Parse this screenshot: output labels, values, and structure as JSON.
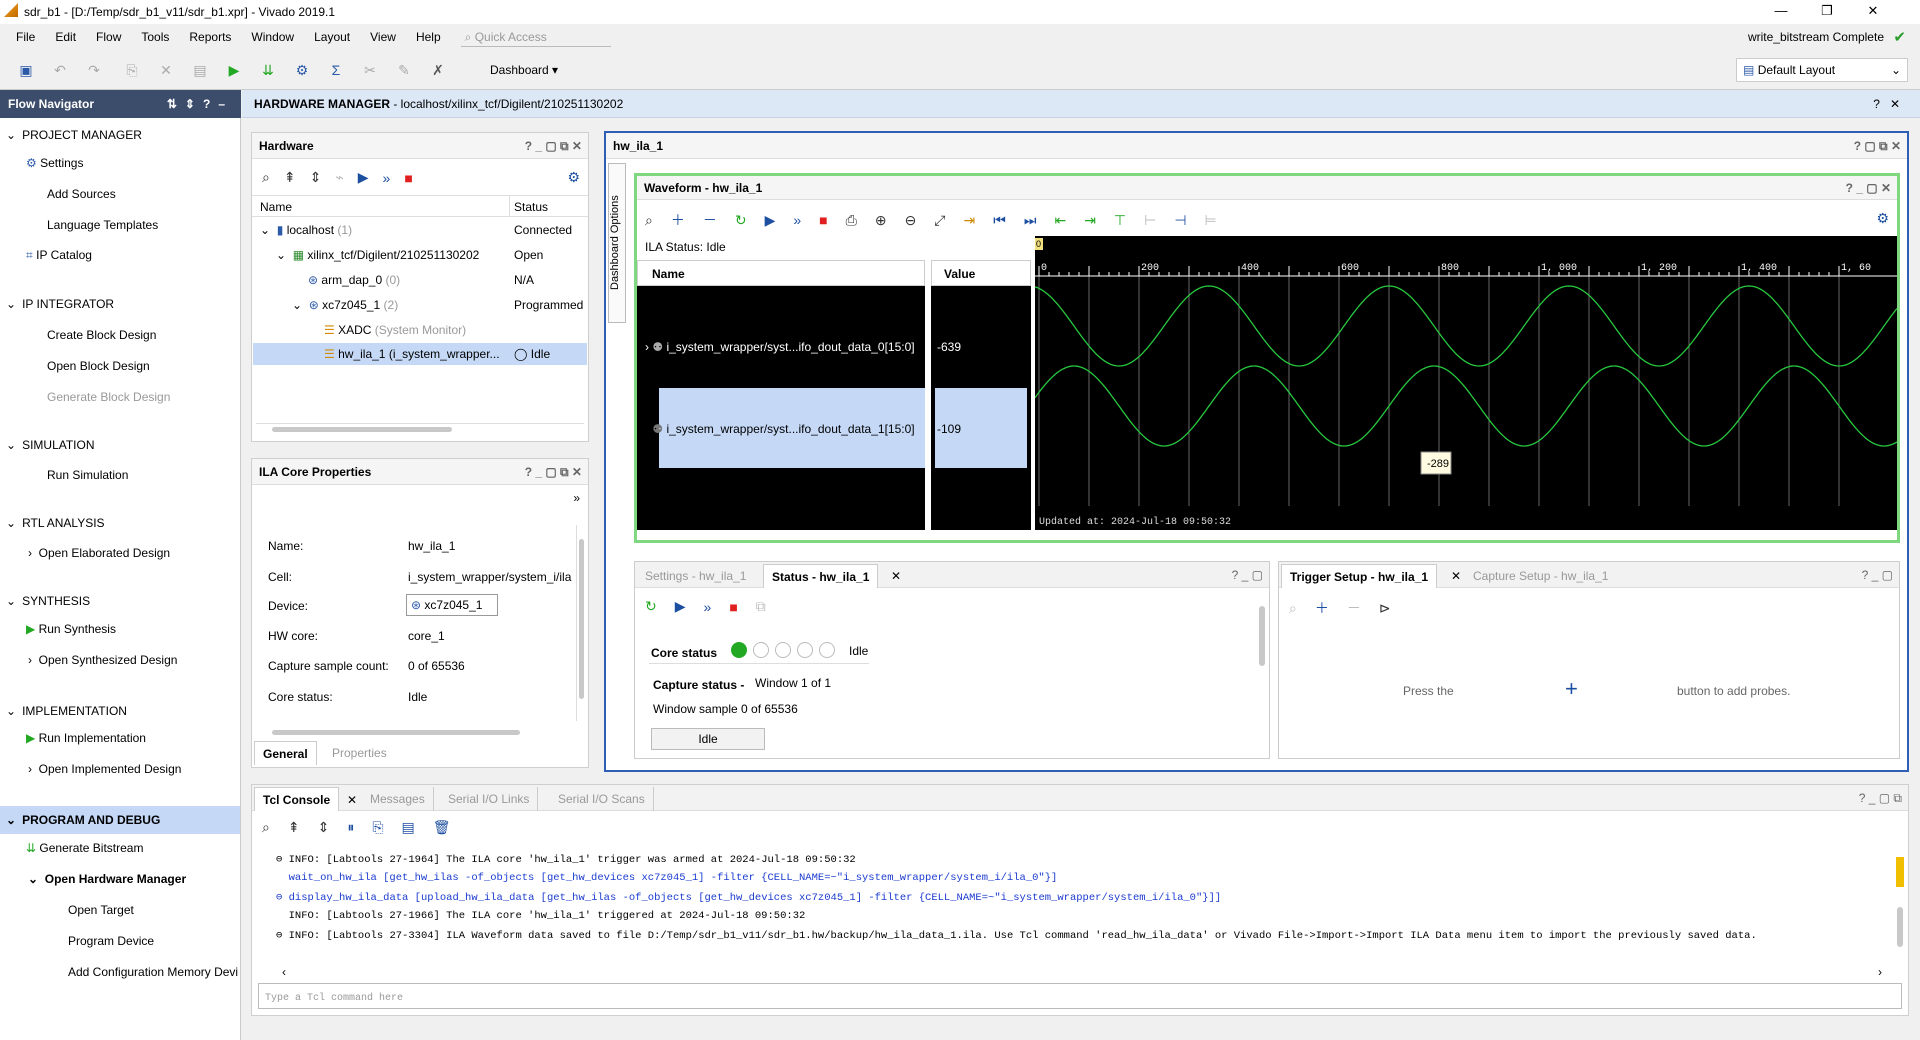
{
  "window": {
    "title": "sdr_b1 - [D:/Temp/sdr_b1_v11/sdr_b1.xpr] - Vivado 2019.1",
    "minimize": "—",
    "maximize": "❐",
    "close": "✕"
  },
  "menu": {
    "items": [
      "File",
      "Edit",
      "Flow",
      "Tools",
      "Reports",
      "Window",
      "Layout",
      "View",
      "Help"
    ],
    "quick_access_placeholder": "Quick Access"
  },
  "status_top": {
    "text": "write_bitstream Complete"
  },
  "toolbar": {
    "dashboard": "Dashboard",
    "layout": "Default Layout"
  },
  "flow_navigator": {
    "title": "Flow Navigator",
    "sections": [
      {
        "label": "PROJECT MANAGER",
        "items": [
          "Settings",
          "Add Sources",
          "Language Templates",
          "IP Catalog"
        ]
      },
      {
        "label": "IP INTEGRATOR",
        "items": [
          "Create Block Design",
          "Open Block Design",
          "Generate Block Design"
        ]
      },
      {
        "label": "SIMULATION",
        "items": [
          "Run Simulation"
        ]
      },
      {
        "label": "RTL ANALYSIS",
        "items": [
          "Open Elaborated Design"
        ]
      },
      {
        "label": "SYNTHESIS",
        "items": [
          "Run Synthesis",
          "Open Synthesized Design"
        ]
      },
      {
        "label": "IMPLEMENTATION",
        "items": [
          "Run Implementation",
          "Open Implemented Design"
        ]
      },
      {
        "label": "PROGRAM AND DEBUG",
        "items": [
          "Generate Bitstream",
          "Open Hardware Manager",
          "Open Target",
          "Program Device",
          "Add Configuration Memory Devi"
        ]
      }
    ]
  },
  "hw_manager": {
    "title": "HARDWARE MANAGER",
    "path": " - localhost/xilinx_tcf/Digilent/210251130202"
  },
  "hardware": {
    "title": "Hardware",
    "col_name": "Name",
    "col_status": "Status",
    "rows": [
      {
        "name": "localhost",
        "count": "(1)",
        "status": "Connected"
      },
      {
        "name": "xilinx_tcf/Digilent/210251130202",
        "count": "",
        "status": "Open"
      },
      {
        "name": "arm_dap_0",
        "count": "(0)",
        "status": "N/A"
      },
      {
        "name": "xc7z045_1",
        "count": "(2)",
        "status": "Programmed"
      },
      {
        "name": "XADC",
        "count": "(System Monitor)",
        "status": ""
      },
      {
        "name": "hw_ila_1",
        "count": "(i_system_wrapper...",
        "status": "Idle"
      }
    ]
  },
  "ila_props": {
    "title": "ILA Core Properties",
    "fields": [
      {
        "label": "Name:",
        "value": "hw_ila_1"
      },
      {
        "label": "Cell:",
        "value": "i_system_wrapper/system_i/ila"
      },
      {
        "label": "Device:",
        "value": "xc7z045_1"
      },
      {
        "label": "HW core:",
        "value": "core_1"
      },
      {
        "label": "Capture sample count:",
        "value": "0 of 65536"
      },
      {
        "label": "Core status:",
        "value": "Idle"
      }
    ],
    "tabs": [
      "General",
      "Properties"
    ]
  },
  "dashboard": {
    "title": "hw_ila_1",
    "side_label": "Dashboard Options"
  },
  "waveform": {
    "title": "Waveform - hw_ila_1",
    "ila_status": "ILA Status:  Idle",
    "col_name": "Name",
    "col_value": "Value",
    "signals": [
      {
        "name": "i_system_wrapper/syst...ifo_dout_data_0[15:0]",
        "value": "-639"
      },
      {
        "name": "i_system_wrapper/syst...ifo_dout_data_1[15:0]",
        "value": "-109"
      }
    ],
    "cursor_marker": "0",
    "ticks": [
      "0",
      "200",
      "400",
      "600",
      "800",
      "1, 000",
      "1, 200",
      "1, 400",
      "1, 60"
    ],
    "tooltip": "-289",
    "updated": "Updated at: 2024-Jul-18 09:50:32"
  },
  "chart_data": {
    "type": "line",
    "xlim": [
      0,
      1600
    ],
    "series": [
      {
        "period_samples": 360,
        "amplitude": 1,
        "phase_deg": 110
      },
      {
        "period_samples": 360,
        "amplitude": 1,
        "phase_deg": 20
      }
    ]
  },
  "settings_status": {
    "tabs": [
      "Settings - hw_ila_1",
      "Status - hw_ila_1"
    ],
    "core_status_label": "Core status",
    "core_status_value": "Idle",
    "capture_status_label": "Capture status - ",
    "capture_status_value": "Window 1 of 1",
    "window_sample": "Window sample 0 of 65536",
    "idle_button": "Idle"
  },
  "trigger": {
    "tabs": [
      "Trigger Setup - hw_ila_1",
      "Capture Setup - hw_ila_1"
    ],
    "hint_left": "Press the",
    "hint_right": "button to add probes."
  },
  "console": {
    "tabs": [
      "Tcl Console",
      "Messages",
      "Serial I/O Links",
      "Serial I/O Scans"
    ],
    "lines": [
      {
        "text": "INFO: [Labtools 27-1964] The ILA core 'hw_ila_1' trigger was armed at 2024-Jul-18 09:50:32",
        "cmd": false
      },
      {
        "text": "wait_on_hw_ila [get_hw_ilas -of_objects [get_hw_devices xc7z045_1] -filter {CELL_NAME=~\"i_system_wrapper/system_i/ila_0\"}]",
        "cmd": true
      },
      {
        "text": "display_hw_ila_data [upload_hw_ila_data [get_hw_ilas -of_objects [get_hw_devices xc7z045_1] -filter {CELL_NAME=~\"i_system_wrapper/system_i/ila_0\"}]]",
        "cmd": true
      },
      {
        "text": "INFO: [Labtools 27-1966] The ILA core 'hw_ila_1' triggered at 2024-Jul-18 09:50:32",
        "cmd": false
      },
      {
        "text": "INFO: [Labtools 27-3304] ILA Waveform data saved to file D:/Temp/sdr_b1_v11/sdr_b1.hw/backup/hw_ila_data_1.ila. Use Tcl command 'read_hw_ila_data' or Vivado File->Import->Import ILA Data menu item to import the previously saved data.",
        "cmd": false
      }
    ],
    "input_placeholder": "Type a Tcl command here"
  },
  "colors": {
    "accent": "#3c4d6b",
    "select": "#c5d9f7",
    "wave": "#27c93f",
    "wave_bg": "#000000",
    "active_border": "#2e5fb5"
  }
}
